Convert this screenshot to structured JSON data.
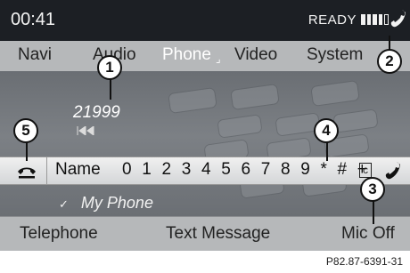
{
  "status": {
    "time": "00:41",
    "ready": "READY",
    "signal_bars": 4,
    "signal_max": 5
  },
  "menu": {
    "items": [
      "Navi",
      "Audio",
      "Phone",
      "Video",
      "System"
    ],
    "active": "Phone"
  },
  "main": {
    "dialed_number": "21999",
    "dial_row": {
      "name_label": "Name",
      "keys": "0 1 2 3 4 5 6 7 8 9 * # +",
      "clear_key": "c"
    },
    "device_name": "My Phone"
  },
  "softkeys": {
    "telephone": "Telephone",
    "text_message": "Text Message",
    "mic_off": "Mic Off"
  },
  "reference": "P82.87-6391-31",
  "callouts": [
    "1",
    "2",
    "3",
    "4",
    "5"
  ],
  "icons": [
    "phone-handset-icon",
    "hangup-icon",
    "call-icon",
    "clear-icon",
    "previous-track-icon",
    "checkmark-icon"
  ]
}
